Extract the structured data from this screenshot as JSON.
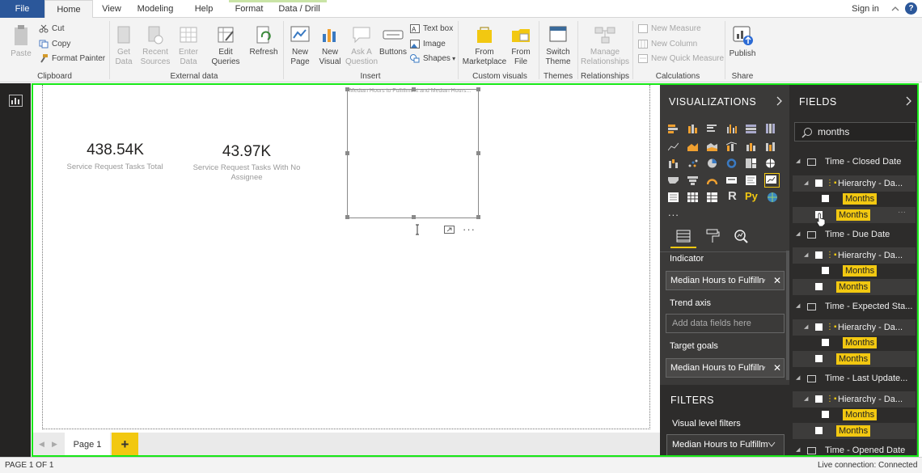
{
  "tabs": {
    "file": "File",
    "home": "Home",
    "view": "View",
    "modeling": "Modeling",
    "help": "Help",
    "format": "Format",
    "data_drill": "Data / Drill"
  },
  "signin": "Sign in",
  "ribbon": {
    "paste": "Paste",
    "cut": "Cut",
    "copy": "Copy",
    "format_painter": "Format Painter",
    "clipboard_group": "Clipboard",
    "get_data": [
      "Get",
      "Data"
    ],
    "recent_sources": [
      "Recent",
      "Sources"
    ],
    "enter_data": [
      "Enter",
      "Data"
    ],
    "edit_queries": [
      "Edit",
      "Queries"
    ],
    "refresh": "Refresh",
    "external_group": "External data",
    "new_page": [
      "New",
      "Page"
    ],
    "new_visual": [
      "New",
      "Visual"
    ],
    "ask_question": [
      "Ask A",
      "Question"
    ],
    "buttons": "Buttons",
    "text_box": "Text box",
    "image": "Image",
    "shapes": "Shapes",
    "insert_group": "Insert",
    "from_marketplace": [
      "From",
      "Marketplace"
    ],
    "from_file": [
      "From",
      "File"
    ],
    "custom_visuals_group": "Custom visuals",
    "switch_theme": [
      "Switch",
      "Theme"
    ],
    "themes_group": "Themes",
    "manage_relationships": [
      "Manage",
      "Relationships"
    ],
    "relationships_group": "Relationships",
    "new_measure": "New Measure",
    "new_column": "New Column",
    "new_quick_measure": "New Quick Measure",
    "calculations_group": "Calculations",
    "publish": "Publish",
    "share_group": "Share"
  },
  "canvas": {
    "card1_value": "438.54K",
    "card1_label": "Service Request Tasks Total",
    "card2_value": "43.97K",
    "card2_label_1": "Service Request Tasks With No",
    "card2_label_2": "Assignee",
    "visual_title": "Median Hours to Fulfillment and Median Hours..."
  },
  "page_tab": "Page 1",
  "add_page": "+",
  "visualizations": {
    "title": "VISUALIZATIONS",
    "more": "...",
    "indicator_label": "Indicator",
    "indicator_value": "Median Hours to Fulfilln",
    "trend_label": "Trend axis",
    "trend_placeholder": "Add data fields here",
    "target_label": "Target goals",
    "target_value": "Median Hours to Fulfilln",
    "filters_title": "FILTERS",
    "visual_filters": "Visual level filters",
    "filter_value": "Median Hours to Fulfillm"
  },
  "fields": {
    "title": "FIELDS",
    "search_value": "months",
    "items": [
      {
        "kind": "table",
        "label": "Time - Closed Date"
      },
      {
        "kind": "hier",
        "label": "Hierarchy - Da..."
      },
      {
        "kind": "month",
        "label": "Months"
      },
      {
        "kind": "month2",
        "label": "Months"
      },
      {
        "kind": "table",
        "label": "Time - Due Date"
      },
      {
        "kind": "hier",
        "label": "Hierarchy - Da..."
      },
      {
        "kind": "month",
        "label": "Months"
      },
      {
        "kind": "month2",
        "label": "Months"
      },
      {
        "kind": "table",
        "label": "Time - Expected Sta..."
      },
      {
        "kind": "hier",
        "label": "Hierarchy - Da..."
      },
      {
        "kind": "month",
        "label": "Months"
      },
      {
        "kind": "month2",
        "label": "Months"
      },
      {
        "kind": "table",
        "label": "Time - Last Update..."
      },
      {
        "kind": "hier",
        "label": "Hierarchy - Da..."
      },
      {
        "kind": "month",
        "label": "Months"
      },
      {
        "kind": "month2",
        "label": "Months"
      },
      {
        "kind": "table",
        "label": "Time - Opened Date"
      }
    ]
  },
  "status": {
    "page": "PAGE 1 OF 1",
    "connection": "Live connection: Connected"
  },
  "colors": {
    "accent_blue": "#2b579a",
    "highlight_yellow": "#f2c811",
    "selection_green": "#17e817",
    "panel_dark": "#3b3a39"
  }
}
